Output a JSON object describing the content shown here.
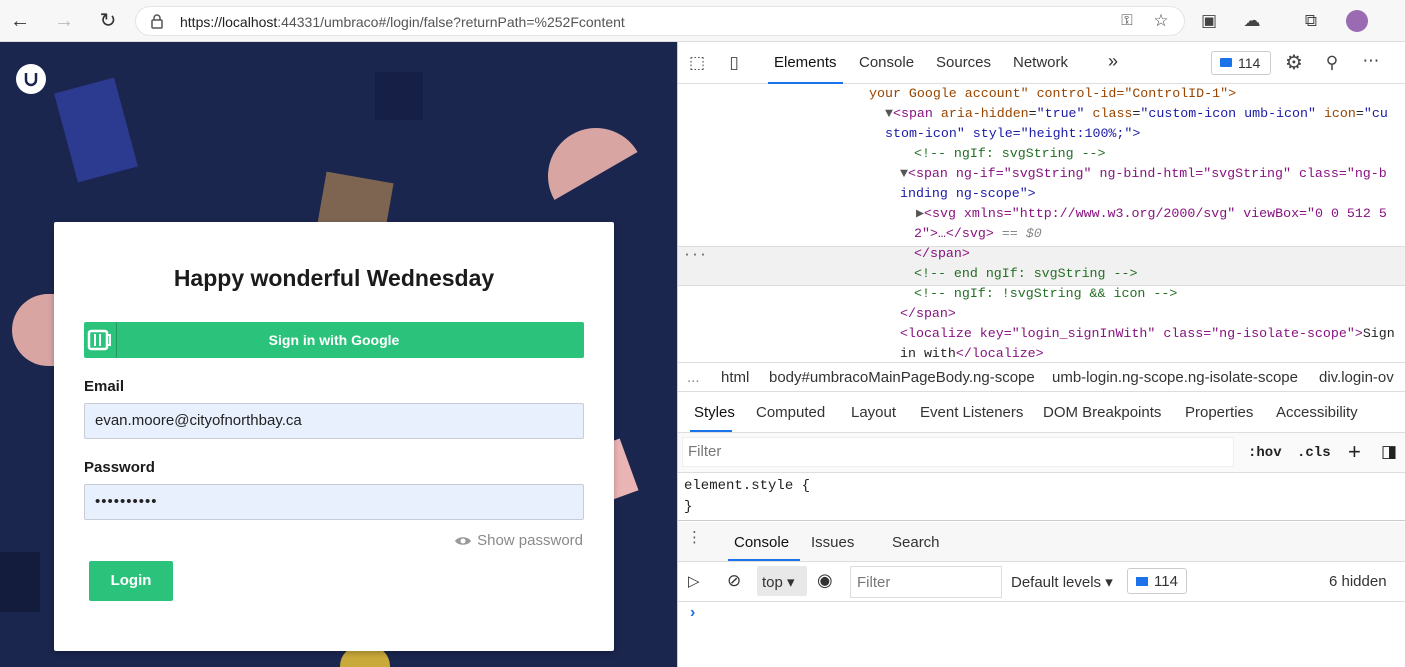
{
  "browser": {
    "url_host": "https://localhost",
    "url_rest": ":44331/umbraco#/login/false?returnPath=%252Fcontent"
  },
  "login": {
    "heading": "Happy wonderful Wednesday",
    "google_label": "Sign in with Google",
    "email_label": "Email",
    "email_value": "evan.moore@cityofnorthbay.ca",
    "password_label": "Password",
    "password_value": "••••••••••",
    "show_password": "Show password",
    "login_label": "Login"
  },
  "devtools": {
    "tabs": [
      "Elements",
      "Console",
      "Sources",
      "Network"
    ],
    "more": "»",
    "issue_count": "114",
    "dom": {
      "l0": "your Google account\" control-id=\"ControlID-1\">",
      "l1a": "span",
      "l1b": "aria-hidden",
      "l1c": "\"true\"",
      "l1d": "class",
      "l1e": "\"custom-icon umb-icon\"",
      "l1f": "icon",
      "l1g": "\"cu",
      "l2": "stom-icon\" style=\"height:100%;\">",
      "l3": "<!-- ngIf: svgString -->",
      "l4": "<span ng-if=\"svgString\" ng-bind-html=\"svgString\" class=\"ng-b",
      "l5": "inding ng-scope\">",
      "l6": "<svg xmlns=\"http://www.w3.org/2000/svg\" viewBox=\"0 0 512 5",
      "l7a": "2\">…</svg>",
      "l7b": "== $0",
      "l8": "</span>",
      "l9": "<!-- end ngIf: svgString -->",
      "l10": "<!-- ngIf: !svgString && icon -->",
      "l11": "</span>",
      "l12a": "<localize key=\"login_signInWith\" class=\"ng-isolate-scope\">",
      "l12b": "Sign",
      "l13a": "in with",
      "l13b": "</localize>"
    },
    "breadcrumbs": [
      "...",
      "html",
      "body#umbracoMainPageBody.ng-scope",
      "umb-login.ng-scope.ng-isolate-scope",
      "div.login-ov"
    ],
    "style_tabs": [
      "Styles",
      "Computed",
      "Layout",
      "Event Listeners",
      "DOM Breakpoints",
      "Properties",
      "Accessibility"
    ],
    "filter_placeholder": "Filter",
    "hov": ":hov",
    "cls": ".cls",
    "element_style": "element.style {",
    "element_style_close": "}",
    "drawer_tabs": [
      "Console",
      "Issues",
      "Search"
    ],
    "console": {
      "context": "top",
      "filter_placeholder": "Filter",
      "levels": "Default levels",
      "count": "114",
      "hidden": "6 hidden",
      "prompt": "›"
    }
  },
  "colors": {
    "brand_bg": "#1b264f",
    "green": "#2bc37c",
    "link_blue": "#1a73e8"
  }
}
